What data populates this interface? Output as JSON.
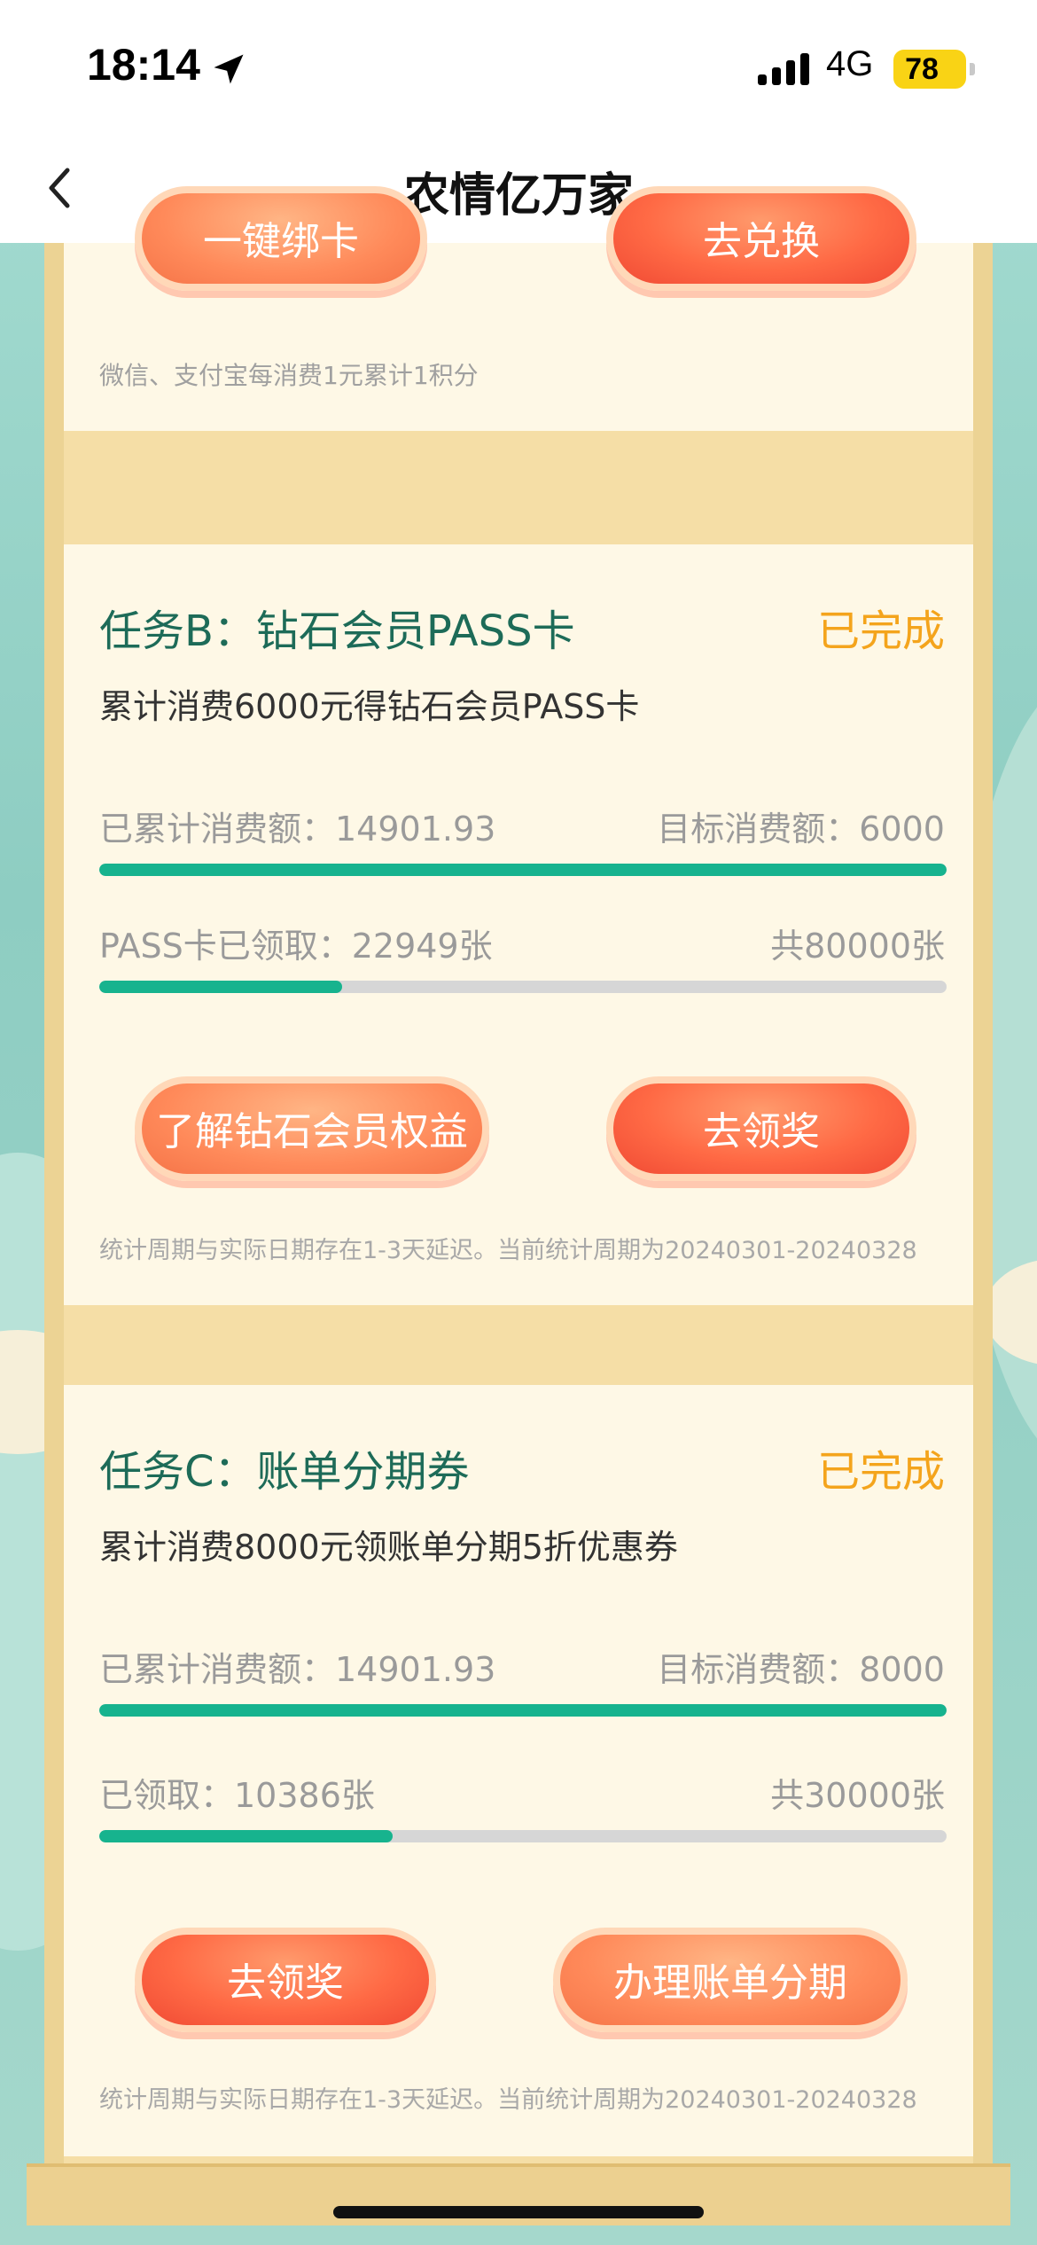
{
  "status_bar": {
    "time": "18:14",
    "network": "4G",
    "battery": "78"
  },
  "nav": {
    "title": "农情亿万家"
  },
  "top_card": {
    "bind_button": "一键绑卡",
    "exchange_button": "去兑换",
    "note": "微信、支付宝每消费1元累计1积分"
  },
  "task_b": {
    "title": "任务B：钻石会员PASS卡",
    "status": "已完成",
    "desc": "累计消费6000元得钻石会员PASS卡",
    "spent_label": "已累计消费额：14901.93",
    "target_label": "目标消费额：6000",
    "spent_progress": 1.0,
    "claimed_label": "PASS卡已领取：22949张",
    "total_label": "共80000张",
    "claimed_progress": 0.2869,
    "benefits_button": "了解钻石会员权益",
    "claim_button": "去领奖",
    "note": "统计周期与实际日期存在1-3天延迟。当前统计周期为20240301-20240328"
  },
  "task_c": {
    "title": "任务C：账单分期券",
    "status": "已完成",
    "desc": "累计消费8000元领账单分期5折优惠券",
    "spent_label": "已累计消费额：14901.93",
    "target_label": "目标消费额：8000",
    "spent_progress": 1.0,
    "claimed_label": "已领取：10386张",
    "total_label": "共30000张",
    "claimed_progress": 0.3462,
    "claim_button": "去领奖",
    "installment_button": "办理账单分期",
    "note": "统计周期与实际日期存在1-3天延迟。当前统计周期为20240301-20240328"
  },
  "colors": {
    "accent_green": "#17b38e",
    "status_orange": "#f4a41c",
    "title_green": "#1d6b58",
    "button_red": "#ff6a45"
  }
}
